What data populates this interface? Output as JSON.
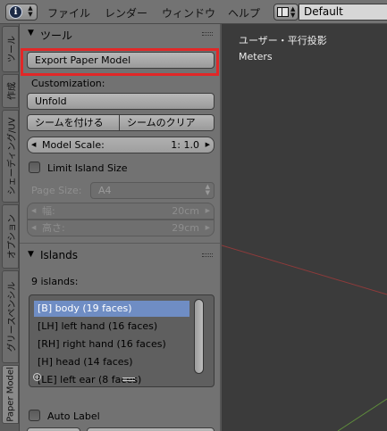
{
  "header": {
    "menus": [
      "ファイル",
      "レンダー",
      "ウィンドウ",
      "ヘルプ"
    ],
    "info_icon": "info-icon",
    "layout": "Default"
  },
  "tabs": [
    "ツール",
    "作成",
    "シェーディング/UV",
    "オプション",
    "グリースペンシル",
    "Paper Model"
  ],
  "active_tab": "Paper Model",
  "tool_panel": {
    "title": "ツール",
    "export_button": "Export Paper Model",
    "customization_label": "Customization:",
    "unfold_button": "Unfold",
    "mark_seam_button": "シームを付ける",
    "clear_seam_button": "シームのクリア",
    "model_scale_label": "Model Scale:",
    "model_scale_value": "1: 1.0",
    "limit_island_label": "Limit Island Size",
    "page_size_label": "Page Size:",
    "page_size_value": "A4",
    "width_label": "幅:",
    "width_value": "20cm",
    "height_label": "高さ:",
    "height_value": "29cm"
  },
  "islands": {
    "title": "Islands",
    "count_label": "9 islands:",
    "items": [
      "[B] body (19 faces)",
      "[LH] left hand (16 faces)",
      "[RH] right hand (16 faces)",
      "[H] head (14 faces)",
      "[LE] left ear (8 faces)"
    ],
    "selected_index": 0,
    "auto_label": "Auto Label"
  },
  "viewport": {
    "view_name": "ユーザー・平行投影",
    "units": "Meters"
  },
  "colors": {
    "highlight": "#e12727",
    "selection": "#6f8dc4"
  }
}
